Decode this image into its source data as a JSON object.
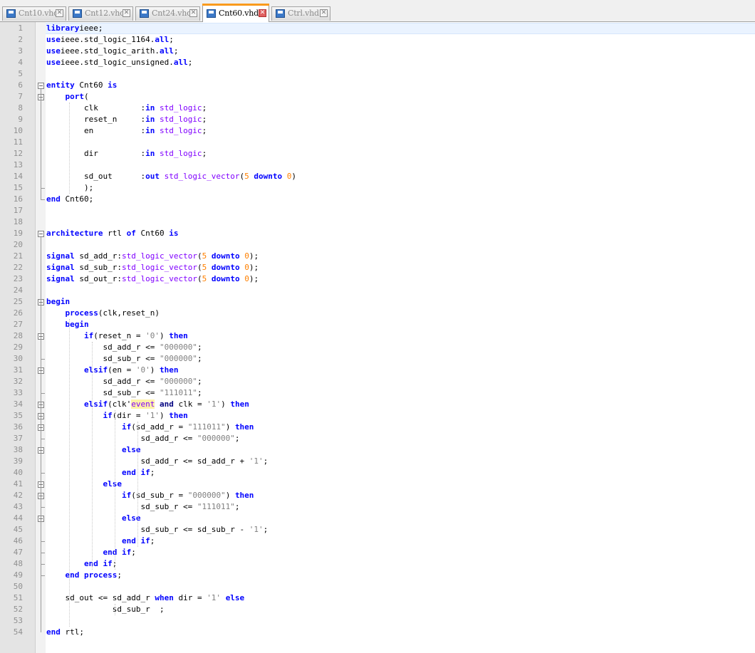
{
  "tabs": [
    {
      "label": "Cnt10.vhd",
      "active": false
    },
    {
      "label": "Cnt12.vhd",
      "active": false
    },
    {
      "label": "Cnt24.vhd",
      "active": false
    },
    {
      "label": "Cnt60.vhd",
      "active": true
    },
    {
      "label": "Ctrl.vhd",
      "active": false
    }
  ],
  "tab_close_glyph": "✕",
  "colors": {
    "keyword": "#0000ff",
    "type": "#8000ff",
    "operator": "#000080",
    "number": "#ff8000",
    "string": "#808080",
    "active_tab_accent": "#fa9a1c"
  },
  "icons": {
    "tab_file": "save-disk-icon",
    "tab_close": "close-icon",
    "fold": "fold-minus-icon"
  },
  "lines": [
    [
      [
        "kw",
        "library"
      ],
      [
        "",
        "ieee;"
      ]
    ],
    [
      [
        "kw",
        "use"
      ],
      [
        "",
        "ieee.std_logic_1164."
      ],
      [
        "kw",
        "all"
      ],
      [
        "",
        ";"
      ]
    ],
    [
      [
        "kw",
        "use"
      ],
      [
        "",
        "ieee.std_logic_arith."
      ],
      [
        "kw",
        "all"
      ],
      [
        "",
        ";"
      ]
    ],
    [
      [
        "kw",
        "use"
      ],
      [
        "",
        "ieee.std_logic_unsigned."
      ],
      [
        "kw",
        "all"
      ],
      [
        "",
        ";"
      ]
    ],
    [],
    [
      [
        "kw",
        "entity"
      ],
      [
        "",
        " Cnt60 "
      ],
      [
        "kw",
        "is"
      ]
    ],
    [
      [
        "",
        "    "
      ],
      [
        "kw",
        "port"
      ],
      [
        "",
        "("
      ]
    ],
    [
      [
        "",
        "        clk         :"
      ],
      [
        "kw",
        "in"
      ],
      [
        "",
        " "
      ],
      [
        "type",
        "std_logic"
      ],
      [
        "",
        ";"
      ]
    ],
    [
      [
        "",
        "        reset_n     :"
      ],
      [
        "kw",
        "in"
      ],
      [
        "",
        " "
      ],
      [
        "type",
        "std_logic"
      ],
      [
        "",
        ";"
      ]
    ],
    [
      [
        "",
        "        en          :"
      ],
      [
        "kw",
        "in"
      ],
      [
        "",
        " "
      ],
      [
        "type",
        "std_logic"
      ],
      [
        "",
        ";"
      ]
    ],
    [],
    [
      [
        "",
        "        dir         :"
      ],
      [
        "kw",
        "in"
      ],
      [
        "",
        " "
      ],
      [
        "type",
        "std_logic"
      ],
      [
        "",
        ";"
      ]
    ],
    [],
    [
      [
        "",
        "        sd_out      :"
      ],
      [
        "kw",
        "out"
      ],
      [
        "",
        " "
      ],
      [
        "type",
        "std_logic_vector"
      ],
      [
        "",
        "("
      ],
      [
        "num",
        "5"
      ],
      [
        "",
        " "
      ],
      [
        "kw",
        "downto"
      ],
      [
        "",
        " "
      ],
      [
        "num",
        "0"
      ],
      [
        "",
        ")"
      ]
    ],
    [
      [
        "",
        "        );"
      ]
    ],
    [
      [
        "kw",
        "end"
      ],
      [
        "",
        " Cnt60;"
      ]
    ],
    [],
    [],
    [
      [
        "kw",
        "architecture"
      ],
      [
        "",
        " rtl "
      ],
      [
        "kw",
        "of"
      ],
      [
        "",
        " Cnt60 "
      ],
      [
        "kw",
        "is"
      ]
    ],
    [],
    [
      [
        "kw",
        "signal"
      ],
      [
        "",
        " sd_add_r:"
      ],
      [
        "type",
        "std_logic_vector"
      ],
      [
        "",
        "("
      ],
      [
        "num",
        "5"
      ],
      [
        "",
        " "
      ],
      [
        "kw",
        "downto"
      ],
      [
        "",
        " "
      ],
      [
        "num",
        "0"
      ],
      [
        "",
        "); "
      ]
    ],
    [
      [
        "kw",
        "signal"
      ],
      [
        "",
        " sd_sub_r:"
      ],
      [
        "type",
        "std_logic_vector"
      ],
      [
        "",
        "("
      ],
      [
        "num",
        "5"
      ],
      [
        "",
        " "
      ],
      [
        "kw",
        "downto"
      ],
      [
        "",
        " "
      ],
      [
        "num",
        "0"
      ],
      [
        "",
        "); "
      ]
    ],
    [
      [
        "kw",
        "signal"
      ],
      [
        "",
        " sd_out_r:"
      ],
      [
        "type",
        "std_logic_vector"
      ],
      [
        "",
        "("
      ],
      [
        "num",
        "5"
      ],
      [
        "",
        " "
      ],
      [
        "kw",
        "downto"
      ],
      [
        "",
        " "
      ],
      [
        "num",
        "0"
      ],
      [
        "",
        "); "
      ]
    ],
    [],
    [
      [
        "kw",
        "begin"
      ]
    ],
    [
      [
        "",
        "    "
      ],
      [
        "kw",
        "process"
      ],
      [
        "",
        "(clk,reset_n)"
      ]
    ],
    [
      [
        "",
        "    "
      ],
      [
        "kw",
        "begin"
      ]
    ],
    [
      [
        "",
        "        "
      ],
      [
        "kw",
        "if"
      ],
      [
        "",
        "(reset_n = "
      ],
      [
        "str",
        "'0'"
      ],
      [
        "",
        ") "
      ],
      [
        "kw",
        "then"
      ]
    ],
    [
      [
        "",
        "            sd_add_r <= "
      ],
      [
        "str",
        "\"000000\""
      ],
      [
        "",
        ";"
      ]
    ],
    [
      [
        "",
        "            sd_sub_r <= "
      ],
      [
        "str",
        "\"000000\""
      ],
      [
        "",
        ";"
      ]
    ],
    [
      [
        "",
        "        "
      ],
      [
        "kw",
        "elsif"
      ],
      [
        "",
        "(en = "
      ],
      [
        "str",
        "'0'"
      ],
      [
        "",
        ") "
      ],
      [
        "kw",
        "then"
      ]
    ],
    [
      [
        "",
        "            sd_add_r <= "
      ],
      [
        "str",
        "\"000000\""
      ],
      [
        "",
        ";"
      ]
    ],
    [
      [
        "",
        "            sd_sub_r <= "
      ],
      [
        "str",
        "\"111011\""
      ],
      [
        "",
        ";"
      ]
    ],
    [
      [
        "",
        "        "
      ],
      [
        "kw",
        "elsif"
      ],
      [
        "",
        "(clk'"
      ],
      [
        "hl",
        "event"
      ],
      [
        "",
        " "
      ],
      [
        "op",
        "and"
      ],
      [
        "",
        " clk = "
      ],
      [
        "str",
        "'1'"
      ],
      [
        "",
        ") "
      ],
      [
        "kw",
        "then"
      ]
    ],
    [
      [
        "",
        "            "
      ],
      [
        "kw",
        "if"
      ],
      [
        "",
        "(dir = "
      ],
      [
        "str",
        "'1'"
      ],
      [
        "",
        ") "
      ],
      [
        "kw",
        "then"
      ]
    ],
    [
      [
        "",
        "                "
      ],
      [
        "kw",
        "if"
      ],
      [
        "",
        "(sd_add_r = "
      ],
      [
        "str",
        "\"111011\""
      ],
      [
        "",
        ") "
      ],
      [
        "kw",
        "then"
      ]
    ],
    [
      [
        "",
        "                    sd_add_r <= "
      ],
      [
        "str",
        "\"000000\""
      ],
      [
        "",
        ";"
      ]
    ],
    [
      [
        "",
        "                "
      ],
      [
        "kw",
        "else"
      ]
    ],
    [
      [
        "",
        "                    sd_add_r <= sd_add_r + "
      ],
      [
        "str",
        "'1'"
      ],
      [
        "",
        ";"
      ]
    ],
    [
      [
        "",
        "                "
      ],
      [
        "kw",
        "end"
      ],
      [
        "",
        " "
      ],
      [
        "kw",
        "if"
      ],
      [
        "",
        ";"
      ]
    ],
    [
      [
        "",
        "            "
      ],
      [
        "kw",
        "else"
      ]
    ],
    [
      [
        "",
        "                "
      ],
      [
        "kw",
        "if"
      ],
      [
        "",
        "(sd_sub_r = "
      ],
      [
        "str",
        "\"000000\""
      ],
      [
        "",
        ") "
      ],
      [
        "kw",
        "then"
      ]
    ],
    [
      [
        "",
        "                    sd_sub_r <= "
      ],
      [
        "str",
        "\"111011\""
      ],
      [
        "",
        ";"
      ]
    ],
    [
      [
        "",
        "                "
      ],
      [
        "kw",
        "else"
      ]
    ],
    [
      [
        "",
        "                    sd_sub_r <= sd_sub_r - "
      ],
      [
        "str",
        "'1'"
      ],
      [
        "",
        ";"
      ]
    ],
    [
      [
        "",
        "                "
      ],
      [
        "kw",
        "end"
      ],
      [
        "",
        " "
      ],
      [
        "kw",
        "if"
      ],
      [
        "",
        ";"
      ]
    ],
    [
      [
        "",
        "            "
      ],
      [
        "kw",
        "end"
      ],
      [
        "",
        " "
      ],
      [
        "kw",
        "if"
      ],
      [
        "",
        ";"
      ]
    ],
    [
      [
        "",
        "        "
      ],
      [
        "kw",
        "end"
      ],
      [
        "",
        " "
      ],
      [
        "kw",
        "if"
      ],
      [
        "",
        ";"
      ]
    ],
    [
      [
        "",
        "    "
      ],
      [
        "kw",
        "end"
      ],
      [
        "",
        " "
      ],
      [
        "kw",
        "process"
      ],
      [
        "",
        ";"
      ]
    ],
    [],
    [
      [
        "",
        "    sd_out <= sd_add_r "
      ],
      [
        "kw",
        "when"
      ],
      [
        "",
        " dir = "
      ],
      [
        "str",
        "'1'"
      ],
      [
        "",
        " "
      ],
      [
        "kw",
        "else"
      ]
    ],
    [
      [
        "",
        "              sd_sub_r  ;"
      ]
    ],
    [],
    [
      [
        "kw",
        "end"
      ],
      [
        "",
        " rtl;"
      ]
    ]
  ]
}
